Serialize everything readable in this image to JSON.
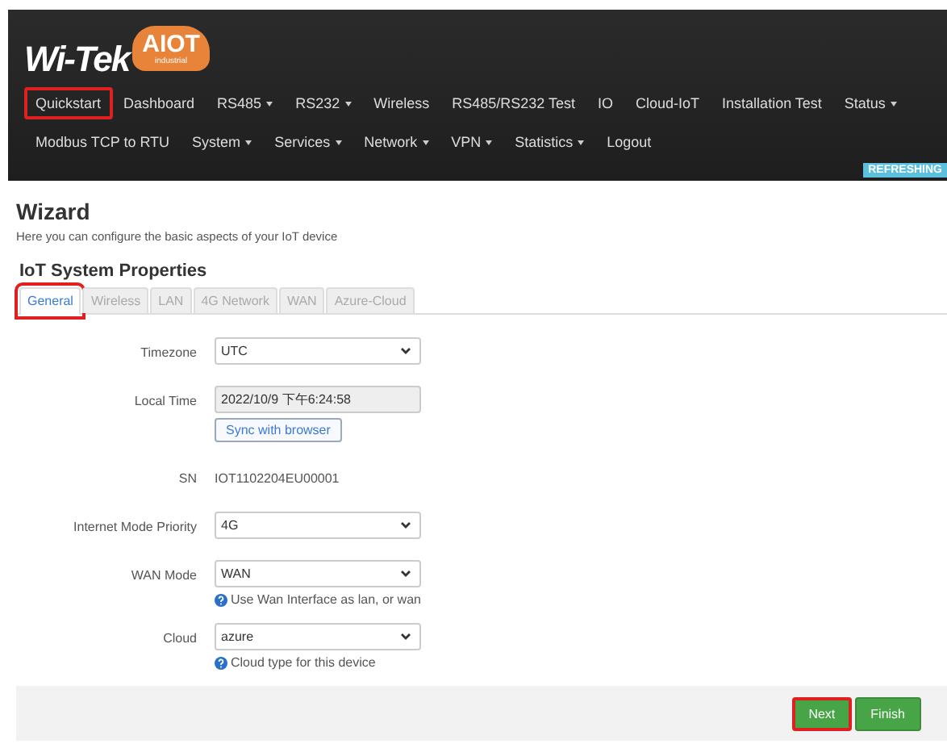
{
  "logo": {
    "brand": "Wi-Tek",
    "badge": "AIOT",
    "sub": "industrial"
  },
  "nav": {
    "primary": [
      {
        "label": "Quickstart",
        "dropdown": false,
        "highlighted": true
      },
      {
        "label": "Dashboard",
        "dropdown": false,
        "highlighted": false
      },
      {
        "label": "RS485",
        "dropdown": true,
        "highlighted": false
      },
      {
        "label": "RS232",
        "dropdown": true,
        "highlighted": false
      },
      {
        "label": "Wireless",
        "dropdown": false,
        "highlighted": false
      },
      {
        "label": "RS485/RS232 Test",
        "dropdown": false,
        "highlighted": false
      },
      {
        "label": "IO",
        "dropdown": false,
        "highlighted": false
      },
      {
        "label": "Cloud-IoT",
        "dropdown": false,
        "highlighted": false
      },
      {
        "label": "Installation Test",
        "dropdown": false,
        "highlighted": false
      },
      {
        "label": "Status",
        "dropdown": true,
        "highlighted": false
      }
    ],
    "secondary": [
      {
        "label": "Modbus TCP to RTU",
        "dropdown": false,
        "highlighted": false
      },
      {
        "label": "System",
        "dropdown": true,
        "highlighted": false
      },
      {
        "label": "Services",
        "dropdown": true,
        "highlighted": false
      },
      {
        "label": "Network",
        "dropdown": true,
        "highlighted": false
      },
      {
        "label": "VPN",
        "dropdown": true,
        "highlighted": false
      },
      {
        "label": "Statistics",
        "dropdown": true,
        "highlighted": false
      },
      {
        "label": "Logout",
        "dropdown": false,
        "highlighted": false
      }
    ],
    "status_badge": "REFRESHING"
  },
  "page": {
    "title": "Wizard",
    "subtitle": "Here you can configure the basic aspects of your IoT device",
    "section": "IoT System Properties"
  },
  "tabs": [
    {
      "label": "General",
      "selected": true,
      "highlighted": true
    },
    {
      "label": "Wireless",
      "selected": false,
      "highlighted": false
    },
    {
      "label": "LAN",
      "selected": false,
      "highlighted": false
    },
    {
      "label": "4G Network",
      "selected": false,
      "highlighted": false
    },
    {
      "label": "WAN",
      "selected": false,
      "highlighted": false
    },
    {
      "label": "Azure-Cloud",
      "selected": false,
      "highlighted": false
    }
  ],
  "fields": [
    {
      "kind": "select",
      "label": "Timezone",
      "value": "UTC"
    },
    {
      "kind": "readonly",
      "label": "Local Time",
      "value": "2022/10/9 下午6:24:58",
      "button": "Sync with browser"
    },
    {
      "kind": "text",
      "label": "SN",
      "value": "IOT1102204EU00001"
    },
    {
      "kind": "select",
      "label": "Internet Mode Priority",
      "value": "4G"
    },
    {
      "kind": "select",
      "label": "WAN Mode",
      "value": "WAN",
      "help": "Use Wan Interface as lan, or wan"
    },
    {
      "kind": "select",
      "label": "Cloud",
      "value": "azure",
      "help": "Cloud type for this device"
    }
  ],
  "buttons": [
    {
      "label": "Next",
      "highlighted": true
    },
    {
      "label": "Finish",
      "highlighted": false
    }
  ]
}
